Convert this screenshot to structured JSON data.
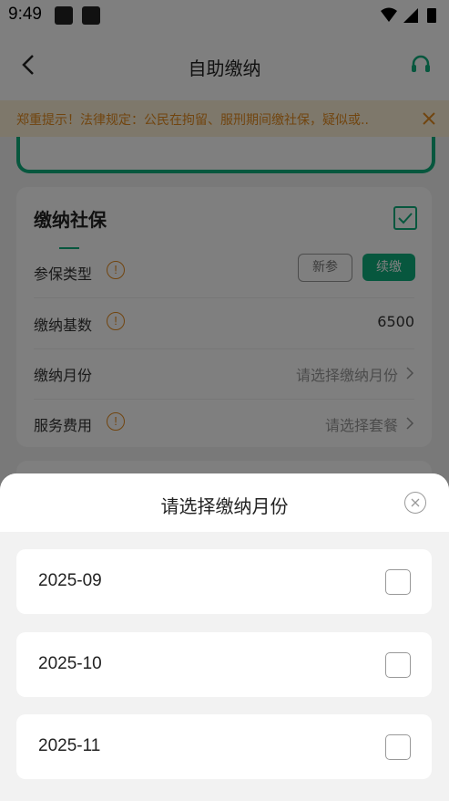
{
  "status_bar": {
    "time": "9:49"
  },
  "nav": {
    "title": "自助缴纳"
  },
  "notice": {
    "text": "郑重提示！法律规定：公民在拘留、服刑期间缴社保，疑似或.."
  },
  "card": {
    "title": "缴纳社保",
    "checked": true,
    "rows": {
      "type": {
        "label": "参保类型",
        "options": [
          "新参",
          "续缴"
        ],
        "selected": "续缴"
      },
      "base": {
        "label": "缴纳基数",
        "value": "6500"
      },
      "month": {
        "label": "缴纳月份",
        "placeholder": "请选择缴纳月份"
      },
      "fee": {
        "label": "服务费用",
        "placeholder": "请选择套餐"
      }
    }
  },
  "colors": {
    "accent": "#0fae7d",
    "warning": "#e38a1e",
    "notice_bg": "#fdf1d6"
  },
  "sheet": {
    "title": "请选择缴纳月份",
    "months": [
      {
        "label": "2025-09",
        "checked": false
      },
      {
        "label": "2025-10",
        "checked": false
      },
      {
        "label": "2025-11",
        "checked": false
      }
    ]
  }
}
